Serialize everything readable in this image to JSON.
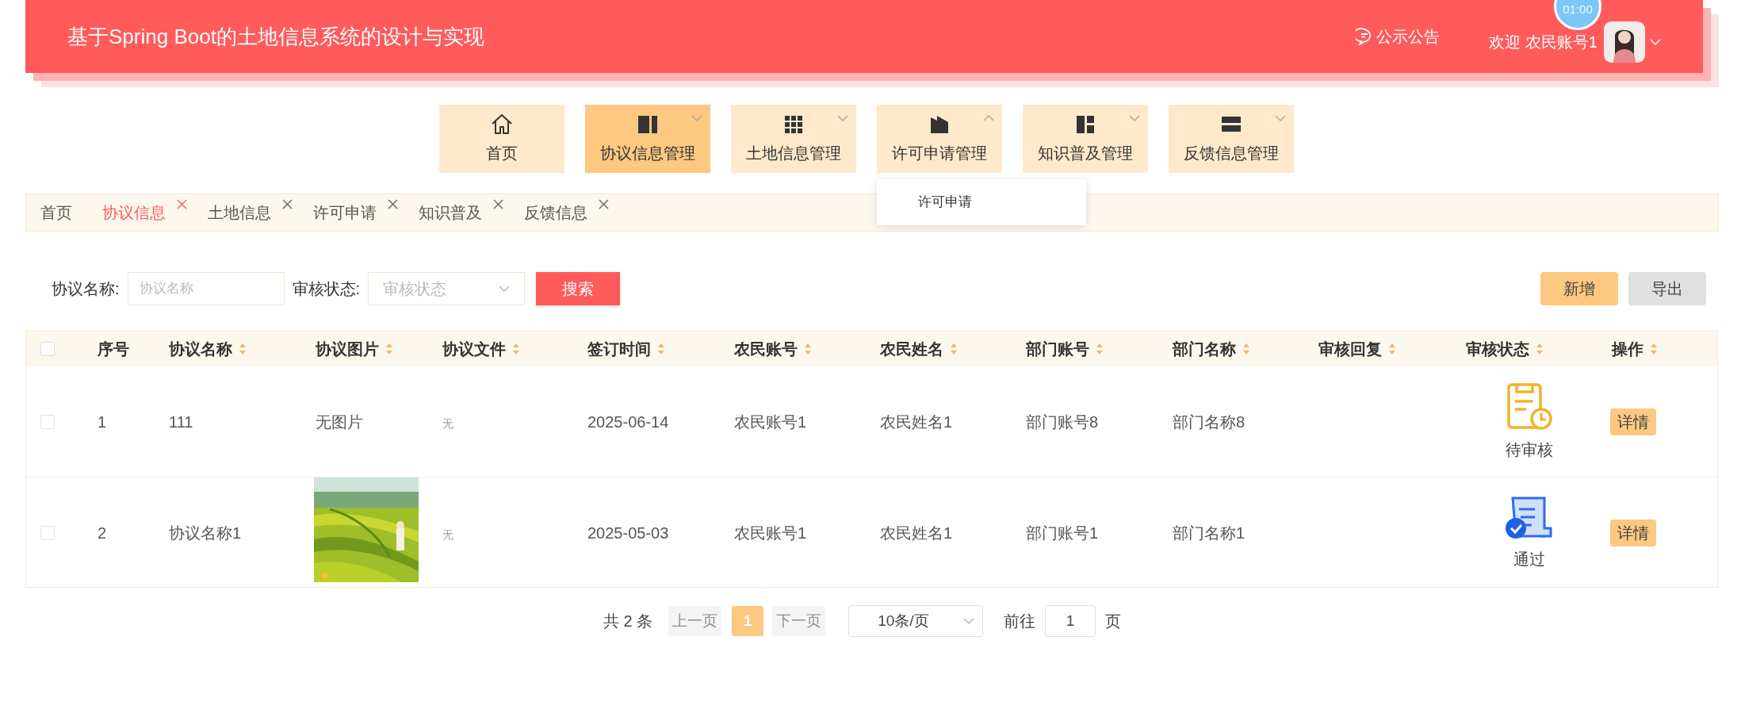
{
  "header": {
    "title": "基于Spring Boot的土地信息系统的设计与实现",
    "notice": "公示公告",
    "welcome": "欢迎 农民账号1",
    "timer": "01:00"
  },
  "nav": [
    {
      "label": "首页",
      "selected": false,
      "has_menu": false
    },
    {
      "label": "协议信息管理",
      "selected": true,
      "has_menu": true,
      "expanded": false
    },
    {
      "label": "土地信息管理",
      "selected": false,
      "has_menu": true,
      "expanded": false
    },
    {
      "label": "许可申请管理",
      "selected": false,
      "has_menu": true,
      "expanded": true,
      "submenu": [
        "许可申请"
      ]
    },
    {
      "label": "知识普及管理",
      "selected": false,
      "has_menu": true,
      "expanded": false
    },
    {
      "label": "反馈信息管理",
      "selected": false,
      "has_menu": true,
      "expanded": false
    }
  ],
  "tabs": [
    {
      "label": "首页",
      "selected": false,
      "closable": false
    },
    {
      "label": "协议信息",
      "selected": true,
      "closable": true
    },
    {
      "label": "土地信息",
      "selected": false,
      "closable": true
    },
    {
      "label": "许可申请",
      "selected": false,
      "closable": true
    },
    {
      "label": "知识普及",
      "selected": false,
      "closable": true
    },
    {
      "label": "反馈信息",
      "selected": false,
      "closable": true
    }
  ],
  "filters": [
    {
      "kind": "input",
      "label": "协议名称:",
      "placeholder": "协议名称"
    },
    {
      "kind": "select",
      "label": "审核状态:",
      "placeholder": "审核状态"
    }
  ],
  "search_button": "搜索",
  "actions": [
    {
      "kind": "primary",
      "label": "新增"
    },
    {
      "kind": "secondary",
      "label": "导出"
    }
  ],
  "table": {
    "all_checked": false,
    "columns": [
      {
        "label": "序号",
        "sortable": false
      },
      {
        "label": "协议名称",
        "sortable": true
      },
      {
        "label": "协议图片",
        "sortable": true
      },
      {
        "label": "协议文件",
        "sortable": true
      },
      {
        "label": "签订时间",
        "sortable": true
      },
      {
        "label": "农民账号",
        "sortable": true
      },
      {
        "label": "农民姓名",
        "sortable": true
      },
      {
        "label": "部门账号",
        "sortable": true
      },
      {
        "label": "部门名称",
        "sortable": true
      },
      {
        "label": "审核回复",
        "sortable": true
      },
      {
        "label": "审核状态",
        "sortable": true
      },
      {
        "label": "操作",
        "sortable": true
      }
    ],
    "rows": [
      {
        "checked": false,
        "index": "1",
        "name": "111",
        "image": {
          "kind": "text",
          "text": "无图片"
        },
        "file": "无",
        "date": "2025-06-14",
        "farmer_account": "农民账号1",
        "farmer_name": "农民姓名1",
        "dept_account": "部门账号8",
        "dept_name": "部门名称8",
        "status": {
          "kind": "pending",
          "label": "待审核"
        },
        "action": "详情"
      },
      {
        "checked": false,
        "index": "2",
        "name": "协议名称1",
        "file": "无",
        "date": "2025-05-03",
        "farmer_account": "农民账号1",
        "farmer_name": "农民姓名1",
        "dept_account": "部门账号1",
        "dept_name": "部门名称1",
        "status": {
          "kind": "approved",
          "label": "通过"
        },
        "action": "详情"
      }
    ]
  },
  "pagination": {
    "total": "共 2 条",
    "prev": "上一页",
    "pages": [
      {
        "label": "1",
        "selected": true
      }
    ],
    "next": "下一页",
    "page_size": "10条/页",
    "goto": "前往",
    "goto_value": "1",
    "suffix": "页"
  }
}
